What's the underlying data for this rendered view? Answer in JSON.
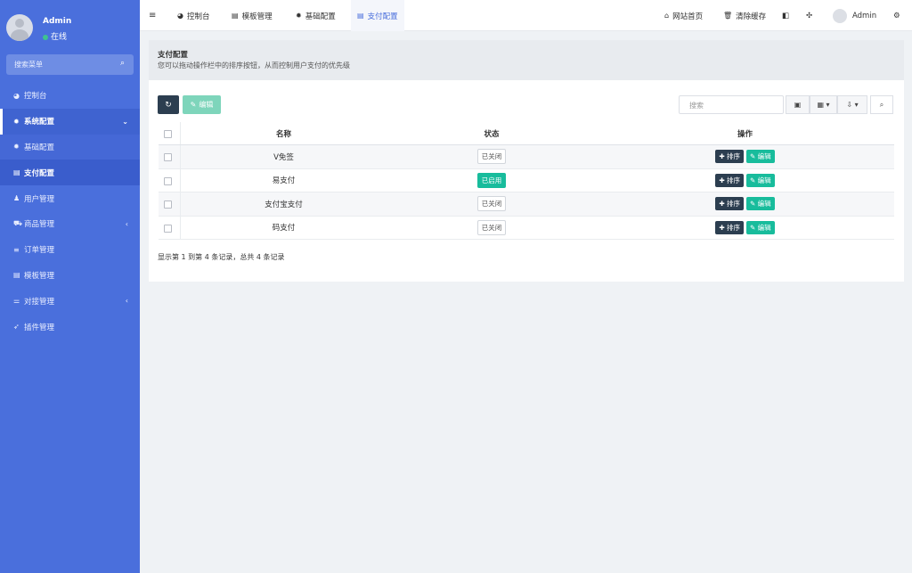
{
  "sidebar": {
    "user": {
      "name": "Admin",
      "status": "在线"
    },
    "search_placeholder": "搜索菜单",
    "items": [
      {
        "label": "控制台",
        "icon": "dashboard-icon",
        "glyph": "◕"
      },
      {
        "label": "系统配置",
        "icon": "gear-icon",
        "glyph": "✹",
        "chevron": "⌄"
      },
      {
        "label": "基础配置",
        "icon": "gear-icon",
        "glyph": "✹"
      },
      {
        "label": "支付配置",
        "icon": "table-icon",
        "glyph": "▤"
      },
      {
        "label": "用户管理",
        "icon": "user-icon",
        "glyph": "♟"
      },
      {
        "label": "商品管理",
        "icon": "cart-icon",
        "glyph": "⛟",
        "chevron": "‹"
      },
      {
        "label": "订单管理",
        "icon": "list-icon",
        "glyph": "≡"
      },
      {
        "label": "模板管理",
        "icon": "table-icon",
        "glyph": "▤"
      },
      {
        "label": "对接管理",
        "icon": "sliders-icon",
        "glyph": "⚌",
        "chevron": "‹"
      },
      {
        "label": "插件管理",
        "icon": "rocket-icon",
        "glyph": "➶"
      }
    ]
  },
  "topbar": {
    "menu_glyph": "≡",
    "tabs": [
      {
        "label": "控制台",
        "icon": "dashboard-icon",
        "glyph": "◕"
      },
      {
        "label": "模板管理",
        "icon": "table-icon",
        "glyph": "▤"
      },
      {
        "label": "基础配置",
        "icon": "gear-icon",
        "glyph": "✹"
      },
      {
        "label": "支付配置",
        "icon": "table-icon",
        "glyph": "▤"
      }
    ],
    "site_home": "网站首页",
    "clear_cache": "清除缓存",
    "user": "Admin"
  },
  "header": {
    "title": "支付配置",
    "description": "您可以拖动操作栏中的排序按钮，从而控制用户支付的优先级"
  },
  "toolbar": {
    "edit_label": "编辑",
    "search_placeholder": "搜索"
  },
  "table": {
    "columns": [
      "名称",
      "状态",
      "操作"
    ],
    "rows": [
      {
        "name": "V免签",
        "status": "已关闭"
      },
      {
        "name": "易支付",
        "status": "已启用"
      },
      {
        "name": "支付宝支付",
        "status": "已关闭"
      },
      {
        "name": "码支付",
        "status": "已关闭"
      }
    ],
    "sort_label": "排序",
    "edit_label": "编辑"
  },
  "pagination_summary": "显示第 1 到第 4 条记录，总共 4 条记录",
  "colors": {
    "sidebar": "#4a6fdc",
    "dark_button": "#2c3e50",
    "success": "#18bc9c"
  }
}
